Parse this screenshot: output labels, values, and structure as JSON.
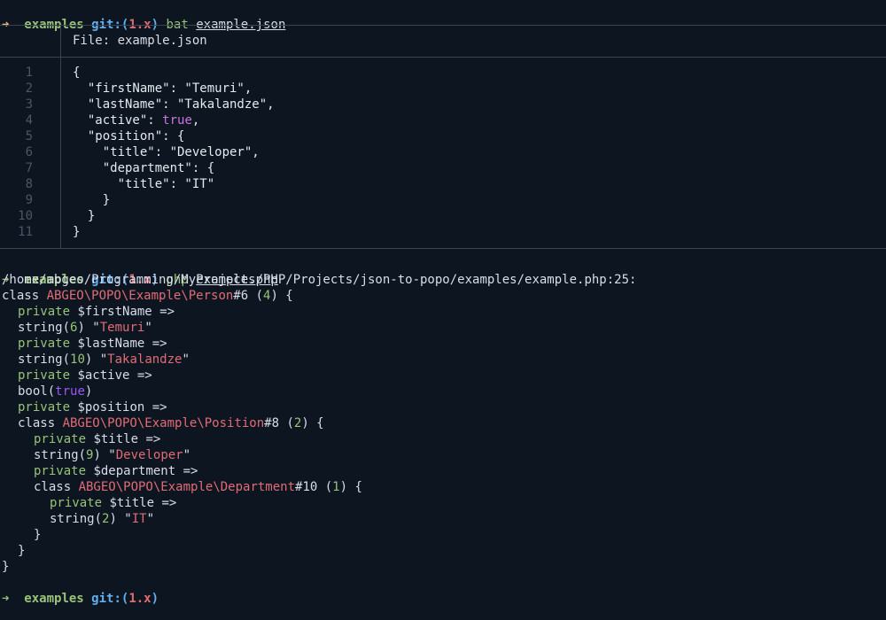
{
  "prompt1": {
    "arrow": "➜",
    "dir": "examples",
    "git_prefix": "git:(",
    "branch": "1.x",
    "git_suffix": ")",
    "command": "bat",
    "argument": "example.json"
  },
  "bat": {
    "file_label": "File: example.json",
    "lines": [
      {
        "num": "1",
        "text": "{"
      },
      {
        "num": "2",
        "text": "  \"firstName\": \"Temuri\","
      },
      {
        "num": "3",
        "text": "  \"lastName\": \"Takalandze\","
      },
      {
        "num": "4",
        "pre": "  \"active\": ",
        "bool": "true",
        "post": ","
      },
      {
        "num": "5",
        "text": "  \"position\": {"
      },
      {
        "num": "6",
        "text": "    \"title\": \"Developer\","
      },
      {
        "num": "7",
        "text": "    \"department\": {"
      },
      {
        "num": "8",
        "text": "      \"title\": \"IT\""
      },
      {
        "num": "9",
        "text": "    }"
      },
      {
        "num": "10",
        "text": "  }"
      },
      {
        "num": "11",
        "text": "}"
      }
    ]
  },
  "prompt2": {
    "arrow": "➜",
    "dir": "examples",
    "git_prefix": "git:(",
    "branch": "1.x",
    "git_suffix": ")",
    "command": "php",
    "argument": "example.php"
  },
  "dump": {
    "path": "/home/abgeo/Programming/MyProjects/PHP/Projects/json-to-popo/examples/example.php:25:",
    "person_class_kw": "class ",
    "person_class": "ABGEO\\POPO\\Example\\Person",
    "person_id": "#6 (",
    "person_count": "4",
    "person_open": ") {",
    "private_kw": "private",
    "firstName_prop": " $firstName =>",
    "firstName_type": "string(",
    "firstName_len": "6",
    "firstName_q1": ") \"",
    "firstName_val": "Temuri",
    "lastName_prop": " $lastName =>",
    "lastName_len": "10",
    "lastName_val": "Takalandze",
    "active_prop": " $active =>",
    "bool_type": "bool(",
    "active_val": "true",
    "close_paren": ")",
    "position_prop": " $position =>",
    "position_class": "ABGEO\\POPO\\Example\\Position",
    "position_id": "#8 (",
    "position_count": "2",
    "title_prop": " $title =>",
    "title_len": "9",
    "title_val": "Developer",
    "department_prop": " $department =>",
    "department_class": "ABGEO\\POPO\\Example\\Department",
    "department_id": "#10 (",
    "department_count": "1",
    "dtitle_len": "2",
    "dtitle_val": "IT",
    "quote": "\"",
    "close_brace": "}"
  },
  "prompt3": {
    "arrow": "➜",
    "dir": "examples",
    "git_prefix": "git:(",
    "branch": "1.x",
    "git_suffix": ")"
  }
}
